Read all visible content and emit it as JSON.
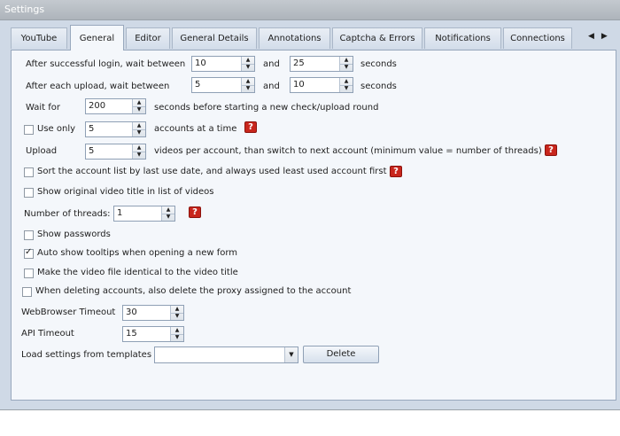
{
  "window": {
    "title": "Settings"
  },
  "tabs": [
    "YouTube",
    "General",
    "Editor",
    "General Details",
    "Annotations",
    "Captcha & Errors",
    "Notifications",
    "Connections"
  ],
  "tab_scroll": {
    "left": "◀",
    "right": "▶"
  },
  "general": {
    "login_wait": {
      "label": "After successful login, wait between",
      "min": "10",
      "and": "and",
      "max": "25",
      "unit": "seconds"
    },
    "upload_wait": {
      "label": "After each upload, wait between",
      "min": "5",
      "and": "and",
      "max": "10",
      "unit": "seconds"
    },
    "wait_for": {
      "label": "Wait for",
      "value": "200",
      "suffix": "seconds before starting a new check/upload round"
    },
    "use_only": {
      "label": "Use only",
      "value": "5",
      "suffix": "accounts at a time",
      "checked": false
    },
    "upload": {
      "label": "Upload",
      "value": "5",
      "suffix": "videos per account, than switch to next account (minimum value = number of threads)"
    },
    "sort_accounts": {
      "label": "Sort the account list by last use date, and always used least used account first",
      "checked": false
    },
    "show_original_title": {
      "label": "Show original video title in list of videos",
      "checked": false
    },
    "threads": {
      "label": "Number of threads:",
      "value": "1"
    },
    "show_passwords": {
      "label": "Show passwords",
      "checked": false
    },
    "auto_tooltips": {
      "label": "Auto show tooltips when opening a new form",
      "checked": true
    },
    "identical_file": {
      "label": "Make the video file identical to the video title",
      "checked": false
    },
    "delete_proxy": {
      "label": "When deleting accounts, also delete the proxy assigned to the account",
      "checked": false
    },
    "webbrowser_timeout": {
      "label": "WebBrowser Timeout",
      "value": "30"
    },
    "api_timeout": {
      "label": "API Timeout",
      "value": "15"
    },
    "templates": {
      "label": "Load settings from templates",
      "selected": "",
      "delete_label": "Delete"
    },
    "help_glyph": "?",
    "spin_up": "▲",
    "spin_down": "▼",
    "combo_arrow": "▼",
    "check_glyph": "✓"
  }
}
